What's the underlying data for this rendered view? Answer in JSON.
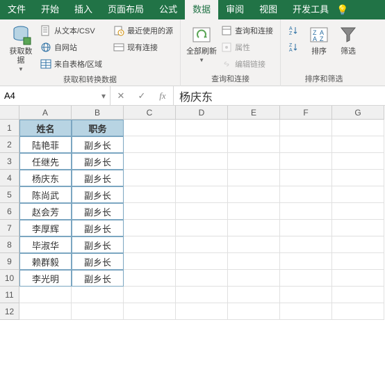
{
  "tabs": {
    "file": "文件",
    "home": "开始",
    "insert": "插入",
    "layout": "页面布局",
    "formulas": "公式",
    "data": "数据",
    "review": "审阅",
    "view": "视图",
    "developer": "开发工具"
  },
  "ribbon": {
    "group1": {
      "big": "获取数\n据",
      "btn1": "从文本/CSV",
      "btn2": "自网站",
      "btn3": "来自表格/区域",
      "btn4": "最近使用的源",
      "btn5": "现有连接",
      "label": "获取和转换数据"
    },
    "group2": {
      "big": "全部刷新",
      "btn1": "查询和连接",
      "btn2": "属性",
      "btn3": "编辑链接",
      "label": "查询和连接"
    },
    "group3": {
      "sort": "排序",
      "filter": "筛选",
      "label": "排序和筛选"
    }
  },
  "namebox": "A4",
  "formula": "杨庆东",
  "chart_data": {
    "type": "table",
    "columns": [
      "姓名",
      "职务"
    ],
    "rows": [
      [
        "陆艳菲",
        "副乡长"
      ],
      [
        "任继先",
        "副乡长"
      ],
      [
        "杨庆东",
        "副乡长"
      ],
      [
        "陈尚武",
        "副乡长"
      ],
      [
        "赵会芳",
        "副乡长"
      ],
      [
        "李厚辉",
        "副乡长"
      ],
      [
        "毕淑华",
        "副乡长"
      ],
      [
        "赖群毅",
        "副乡长"
      ],
      [
        "李光明",
        "副乡长"
      ]
    ]
  },
  "col_letters": [
    "A",
    "B",
    "C",
    "D",
    "E",
    "F",
    "G"
  ],
  "row_numbers": [
    1,
    2,
    3,
    4,
    5,
    6,
    7,
    8,
    9,
    10,
    11,
    12
  ]
}
